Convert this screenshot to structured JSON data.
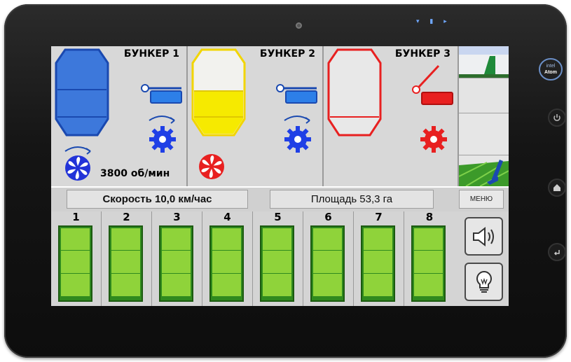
{
  "device": {
    "brand_badge": "intel Atom"
  },
  "bunkers": [
    {
      "title": "БУНКЕР 1",
      "color": "#3a73d8",
      "fill_level": 1.0
    },
    {
      "title": "БУНКЕР 2",
      "color": "#f5e000",
      "fill_level": 0.5
    },
    {
      "title": "БУНКЕР 3",
      "color": "#e82020",
      "fill_level": 0.0
    }
  ],
  "fan": {
    "rpm_text": "3800 об/мин"
  },
  "info": {
    "speed_text": "Скорость 10,0 км/час",
    "area_text": "Площадь 53,3 га",
    "menu_label": "МЕНЮ"
  },
  "rows": [
    {
      "label": "1"
    },
    {
      "label": "2"
    },
    {
      "label": "3"
    },
    {
      "label": "4"
    },
    {
      "label": "5"
    },
    {
      "label": "6"
    },
    {
      "label": "7"
    },
    {
      "label": "8"
    }
  ],
  "controls": {
    "sound_icon": "speaker-icon",
    "light_icon": "lightbulb-icon"
  },
  "colors": {
    "row_active": "#8fd33a",
    "row_border": "#2f8a1e"
  }
}
